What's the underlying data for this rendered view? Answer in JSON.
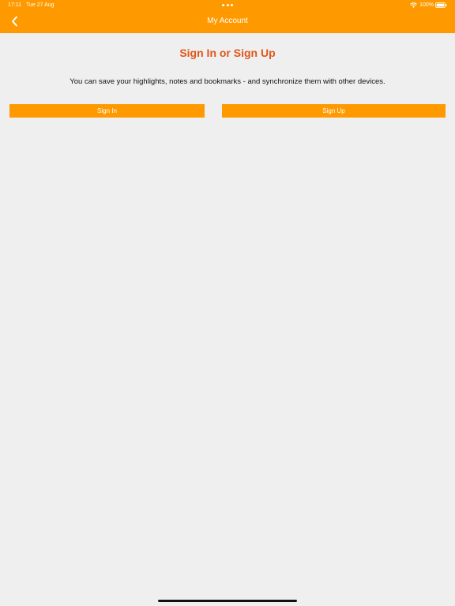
{
  "status_bar": {
    "time": "17:11",
    "date": "Tue 27 Aug",
    "battery": "100%",
    "icons": [
      "wifi-icon",
      "battery-icon",
      "multitasking-dots-icon"
    ]
  },
  "nav": {
    "title": "My Account",
    "back_icon": "chevron-left-icon"
  },
  "main": {
    "heading": "Sign In or Sign Up",
    "description": "You can save your highlights, notes and bookmarks - and synchronize them with other devices.",
    "sign_in_label": "Sign In",
    "sign_up_label": "Sign Up"
  },
  "colors": {
    "accent": "#ff9900",
    "heading": "#e0561a",
    "background": "#efefef"
  }
}
